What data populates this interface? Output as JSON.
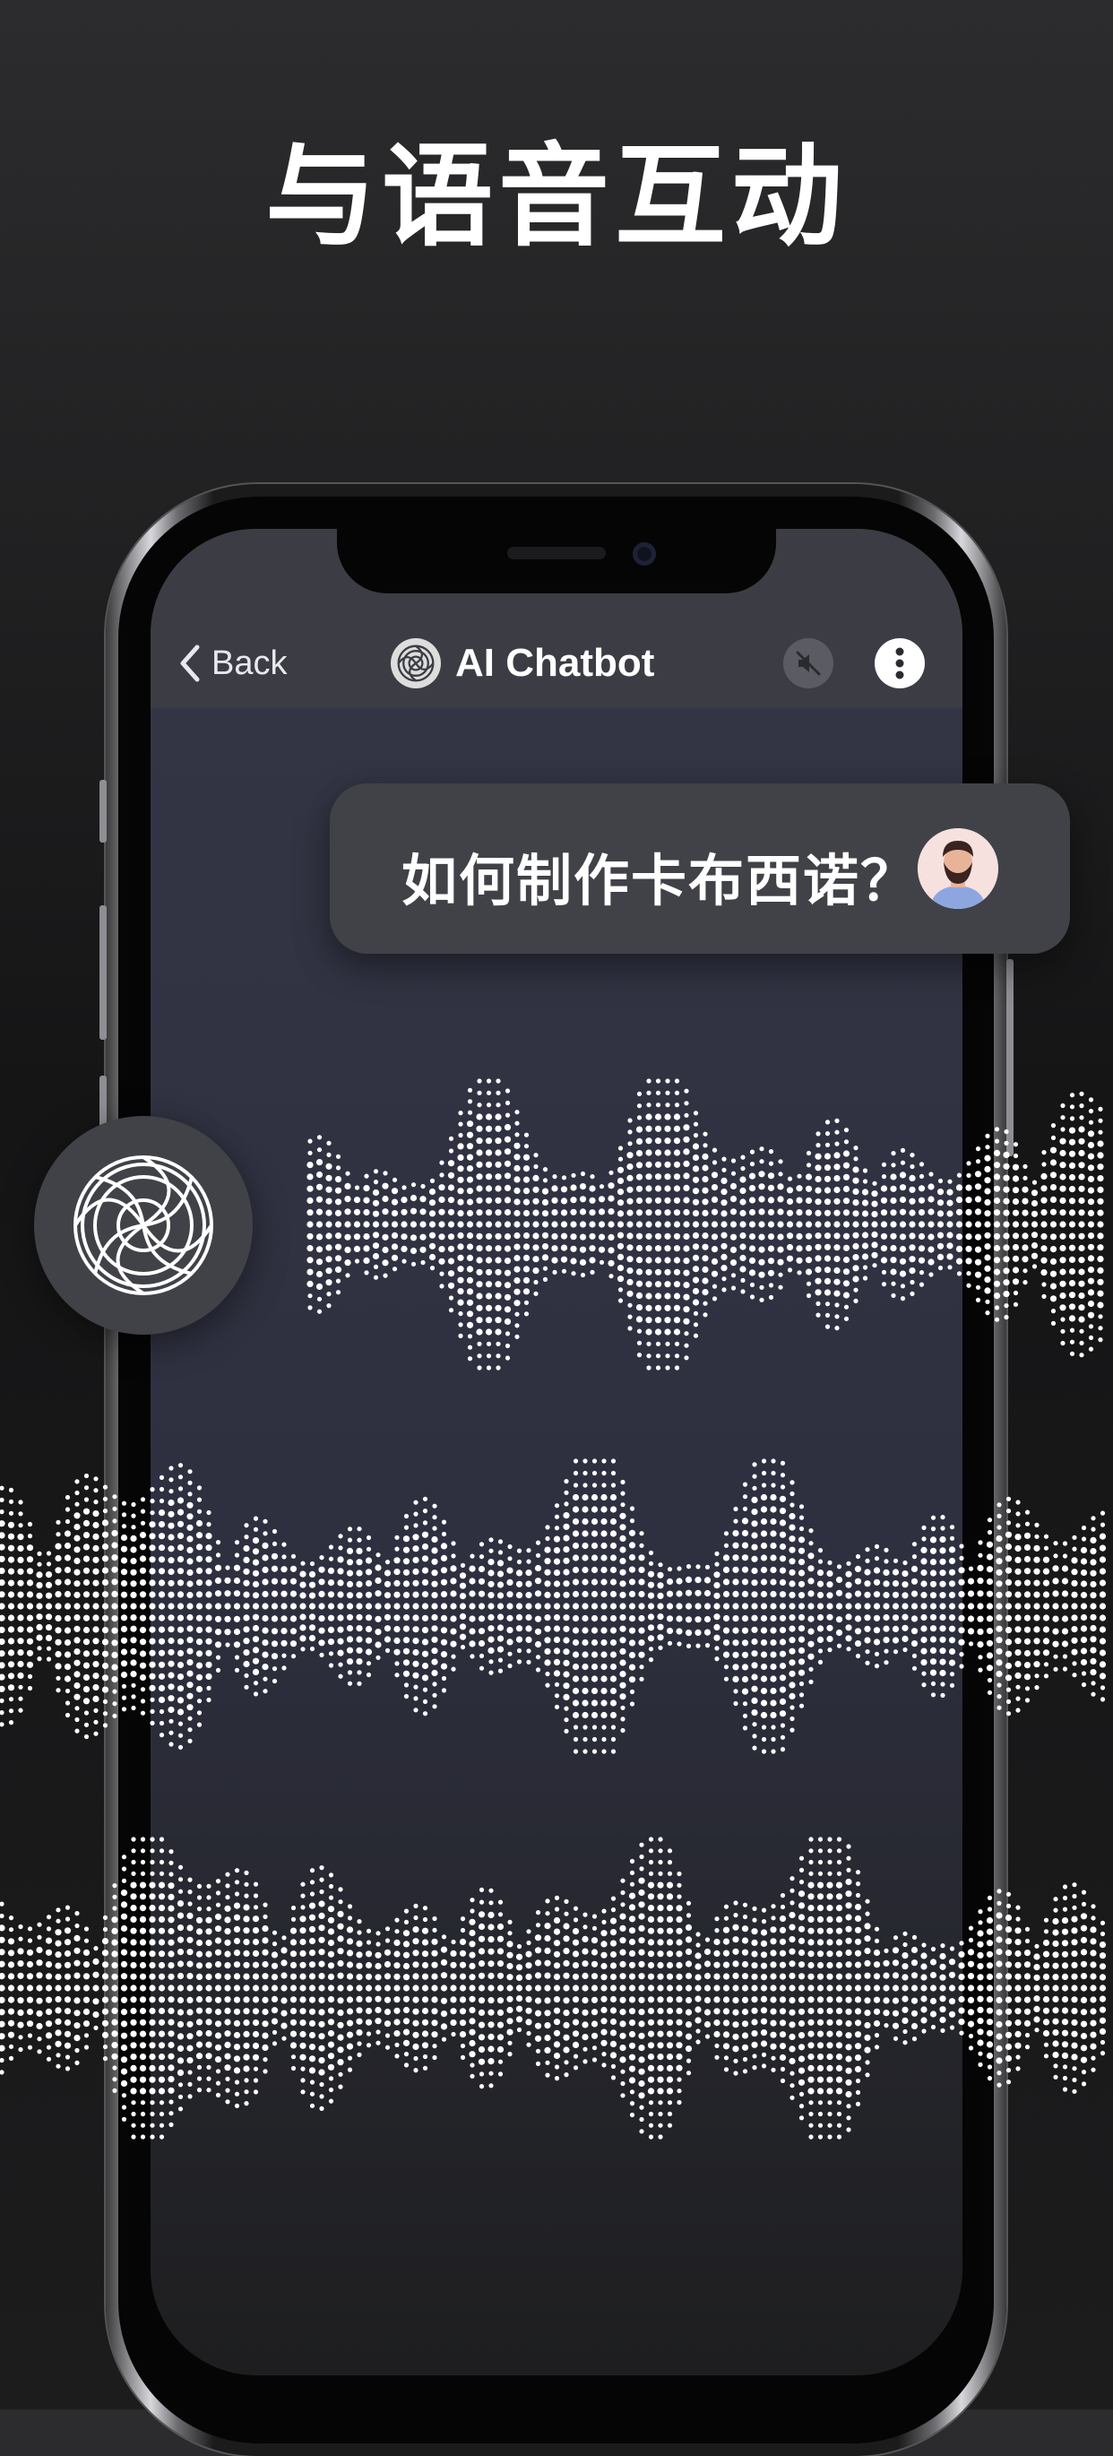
{
  "headline": "与语音互动",
  "navbar": {
    "back_label": "Back",
    "title": "AI Chatbot",
    "mute_icon": "speaker-muted-icon",
    "more_icon": "more-vertical-icon"
  },
  "chat": {
    "user_message": "如何制作卡布西诺？"
  },
  "colors": {
    "background": "#1c1c1d",
    "screen": "#2e3040",
    "bubble": "#414247",
    "waveform": "#ffffff"
  }
}
